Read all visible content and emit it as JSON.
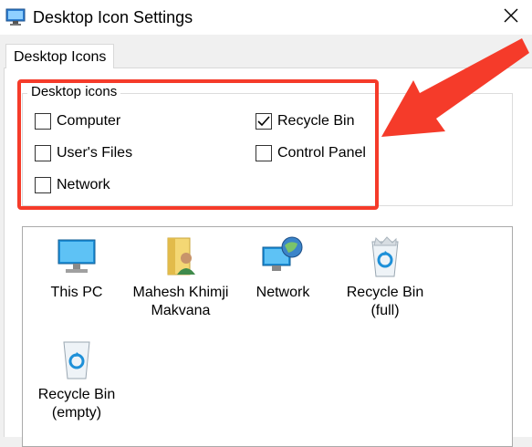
{
  "window": {
    "title": "Desktop Icon Settings"
  },
  "tabs": [
    {
      "label": "Desktop Icons"
    }
  ],
  "group": {
    "label": "Desktop icons",
    "checkboxes": [
      {
        "label": "Computer",
        "checked": false
      },
      {
        "label": "Recycle Bin",
        "checked": true
      },
      {
        "label": "User's Files",
        "checked": false
      },
      {
        "label": "Control Panel",
        "checked": false
      },
      {
        "label": "Network",
        "checked": false
      }
    ]
  },
  "icons": [
    {
      "label": "This PC",
      "icon": "computer-icon"
    },
    {
      "label": "Mahesh Khimji\nMakvana",
      "icon": "user-folder-icon"
    },
    {
      "label": "Network",
      "icon": "network-icon"
    },
    {
      "label": "Recycle Bin\n(full)",
      "icon": "recycle-bin-full-icon"
    },
    {
      "label": "Recycle Bin\n(empty)",
      "icon": "recycle-bin-empty-icon"
    }
  ],
  "colors": {
    "highlight": "#f53b2a",
    "accent": "#1e90d8"
  }
}
